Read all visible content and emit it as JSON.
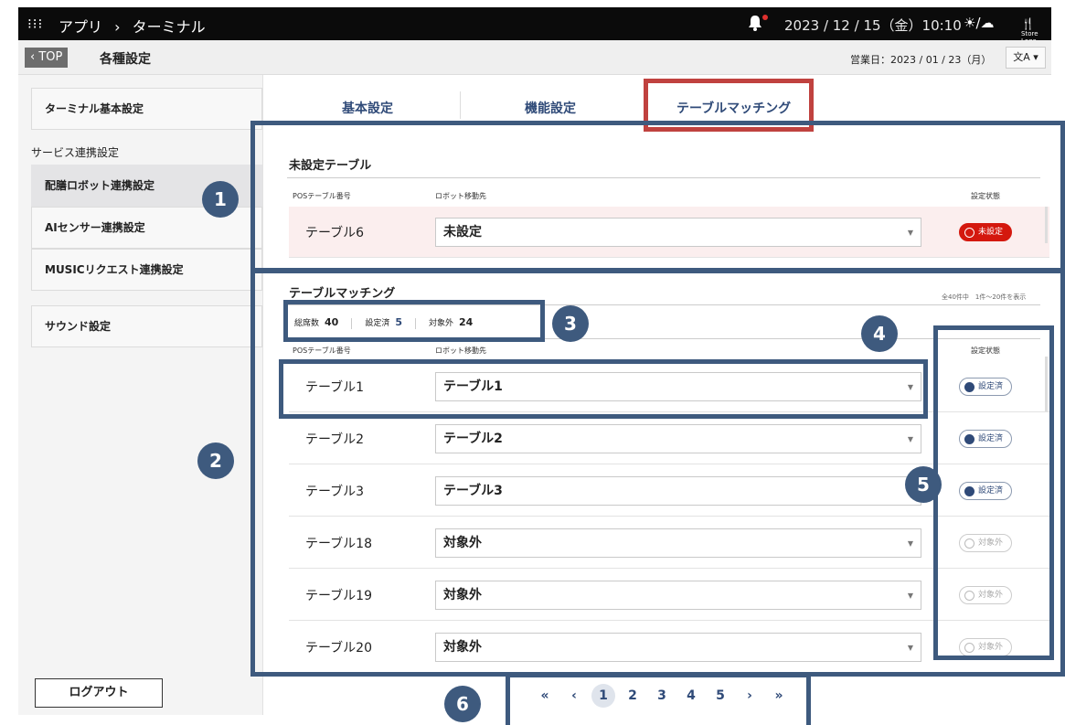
{
  "topbar": {
    "apps_icon": "grid-icon",
    "crumb_app": "アプリ",
    "crumb_sep": "›",
    "crumb_current": "ターミナル",
    "datetime": "2023 / 12 / 15（金）10:10",
    "store_logo": "Store Logo"
  },
  "subheader": {
    "back_label": "TOP",
    "title": "各種設定",
    "business_date": "営業日：2023 / 01 / 23（月）",
    "lang_label": "文A"
  },
  "sidebar": {
    "item_terminal": "ターミナル基本設定",
    "heading_service": "サービス連携設定",
    "item_robot": "配膳ロボット連携設定",
    "item_ai": "AIセンサー連携設定",
    "item_music": "MUSICリクエスト連携設定",
    "item_sound": "サウンド設定",
    "logout": "ログアウト"
  },
  "tabs": [
    "基本設定",
    "機能設定",
    "テーブルマッチング"
  ],
  "unset_section": {
    "title": "未設定テーブル",
    "col_pos": "POSテーブル番号",
    "col_robot": "ロボット移動先",
    "col_status": "設定状態",
    "rows": [
      {
        "name": "テーブル6",
        "dest": "未設定",
        "status": "未設定"
      }
    ]
  },
  "matching_section": {
    "title": "テーブルマッチング",
    "count_info": "全40件中　1件〜20件を表示",
    "stats": {
      "total_label": "総席数",
      "total": "40",
      "set_label": "設定済",
      "set": "5",
      "excluded_label": "対象外",
      "excluded": "24"
    },
    "col_pos": "POSテーブル番号",
    "col_robot": "ロボット移動先",
    "col_status": "設定状態",
    "rows": [
      {
        "name": "テーブル1",
        "dest": "テーブル1",
        "status": "設定済"
      },
      {
        "name": "テーブル2",
        "dest": "テーブル2",
        "status": "設定済"
      },
      {
        "name": "テーブル3",
        "dest": "テーブル3",
        "status": "設定済"
      },
      {
        "name": "テーブル18",
        "dest": "対象外",
        "status": "対象外"
      },
      {
        "name": "テーブル19",
        "dest": "対象外",
        "status": "対象外"
      },
      {
        "name": "テーブル20",
        "dest": "対象外",
        "status": "対象外"
      }
    ]
  },
  "pager": {
    "first": "«",
    "prev": "‹",
    "pages": [
      "1",
      "2",
      "3",
      "4",
      "5"
    ],
    "next": "›",
    "last": "»"
  },
  "badges": [
    "1",
    "2",
    "3",
    "4",
    "5",
    "6"
  ],
  "colors": {
    "accent": "#3e5a7e",
    "tab_highlight": "#c0423f",
    "unset": "#d4180e"
  }
}
